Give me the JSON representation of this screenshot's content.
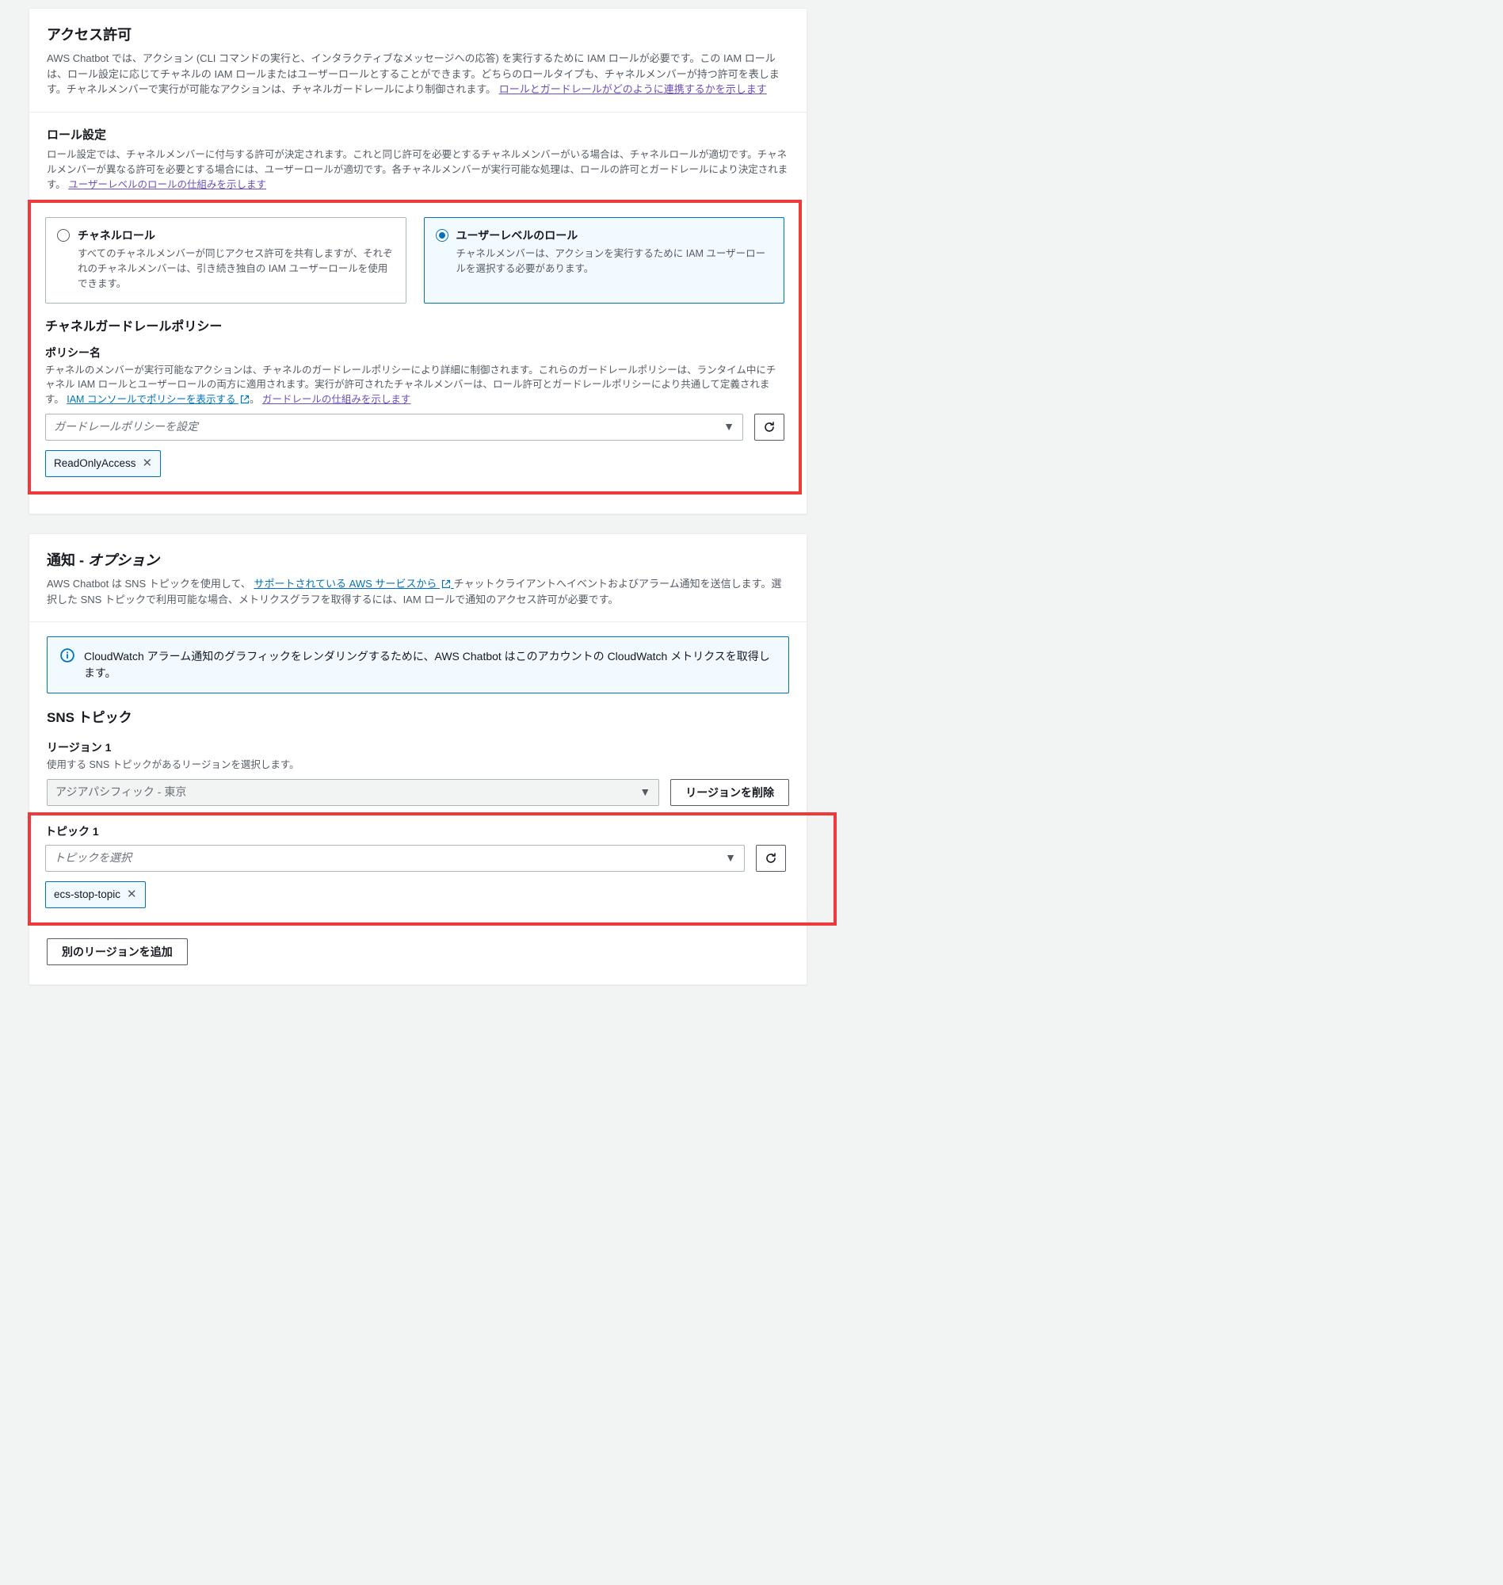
{
  "permissions": {
    "title": "アクセス許可",
    "desc_pre": "AWS Chatbot では、アクション (CLI コマンドの実行と、インタラクティブなメッセージへの応答) を実行するために IAM ロールが必要です。この IAM ロールは、ロール設定に応じてチャネルの IAM ロールまたはユーザーロールとすることができます。どちらのロールタイプも、チャネルメンバーが持つ許可を表します。チャネルメンバーで実行が可能なアクションは、チャネルガードレールにより制御されます。",
    "link1": "ロールとガードレールがどのように連携するかを示します",
    "role_settings_title": "ロール設定",
    "role_settings_desc": "ロール設定では、チャネルメンバーに付与する許可が決定されます。これと同じ許可を必要とするチャネルメンバーがいる場合は、チャネルロールが適切です。チャネルメンバーが異なる許可を必要とする場合には、ユーザーロールが適切です。各チャネルメンバーが実行可能な処理は、ロールの許可とガードレールにより決定されます。",
    "link2": "ユーザーレベルのロールの仕組みを示します",
    "radio_channel_title": "チャネルロール",
    "radio_channel_desc": "すべてのチャネルメンバーが同じアクセス許可を共有しますが、それぞれのチャネルメンバーは、引き続き独自の IAM ユーザーロールを使用できます。",
    "radio_user_title": "ユーザーレベルのロール",
    "radio_user_desc": "チャネルメンバーは、アクションを実行するために IAM ユーザーロールを選択する必要があります。",
    "guardrail_title": "チャネルガードレールポリシー",
    "policy_label": "ポリシー名",
    "policy_desc": "チャネルのメンバーが実行可能なアクションは、チャネルのガードレールポリシーにより詳細に制御されます。これらのガードレールポリシーは、ランタイム中にチャネル IAM ロールとユーザーロールの両方に適用されます。実行が許可されたチャネルメンバーは、ロール許可とガードレールポリシーにより共通して定義されます。",
    "link3": "IAM コンソールでポリシーを表示する",
    "link4": "ガードレールの仕組みを示します",
    "policy_placeholder": "ガードレールポリシーを設定",
    "policy_chip": "ReadOnlyAccess"
  },
  "notifications": {
    "title_pre": "通知 - ",
    "title_opt": "オプション",
    "desc_pre": "AWS Chatbot は SNS トピックを使用して、",
    "desc_link": "サポートされている AWS サービスから",
    "desc_post": "チャットクライアントへイベントおよびアラーム通知を送信します。選択した SNS トピックで利用可能な場合、メトリクスグラフを取得するには、IAM ロールで通知のアクセス許可が必要です。",
    "info": "CloudWatch アラーム通知のグラフィックをレンダリングするために、AWS Chatbot はこのアカウントの CloudWatch メトリクスを取得します。",
    "sns_title": "SNS トピック",
    "region_label": "リージョン 1",
    "region_desc": "使用する SNS トピックがあるリージョンを選択します。",
    "region_value": "アジアパシフィック - 東京",
    "region_delete": "リージョンを削除",
    "topic_label": "トピック 1",
    "topic_placeholder": "トピックを選択",
    "topic_chip": "ecs-stop-topic",
    "add_region": "別のリージョンを追加"
  }
}
